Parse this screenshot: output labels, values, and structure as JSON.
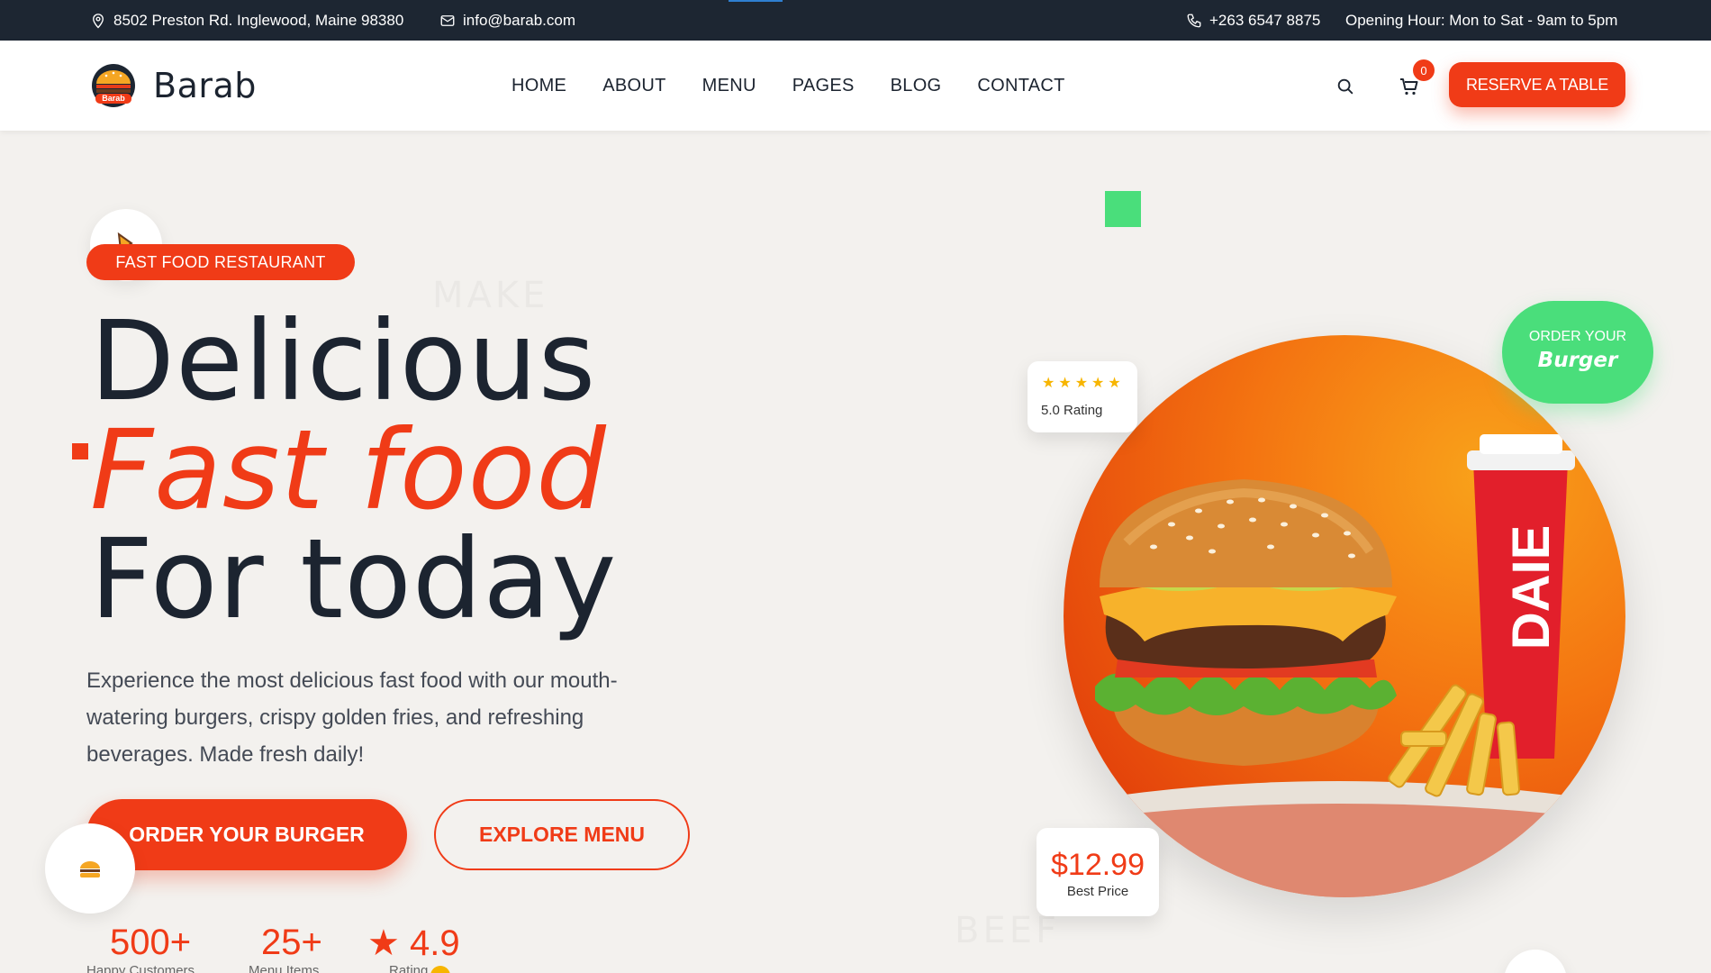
{
  "topbar": {
    "address": "8502 Preston Rd. Inglewood, Maine 98380",
    "email": "info@barab.com",
    "phone": "+263 6547 8875",
    "hours": "Opening Hour: Mon to Sat - 9am to 5pm"
  },
  "header": {
    "logo_text": "Barab",
    "logo_mark_text": "Barab",
    "nav": [
      "HOME",
      "ABOUT",
      "MENU",
      "PAGES",
      "BLOG",
      "CONTACT"
    ],
    "cart_count": "0",
    "reserve_label": "RESERVE A TABLE",
    "icons": [
      "search-icon",
      "cart-icon"
    ]
  },
  "hero": {
    "badge": "FAST FOOD RESTAURANT",
    "title_line1": "Delicious",
    "title_line2": "Fast food",
    "title_line3": "For today",
    "description": "Experience the most delicious fast food with our mouth-watering burgers, crispy golden fries, and refreshing beverages. Made fresh daily!",
    "primary_button": "ORDER YOUR BURGER",
    "secondary_button": "EXPLORE MENU",
    "stats": [
      {
        "value": "500+",
        "label": "Happy Customers"
      },
      {
        "value": "25+",
        "label": "Menu Items"
      },
      {
        "value": "★ 4.9",
        "label": "Rating"
      }
    ]
  },
  "showcase": {
    "stars": "★★★★★",
    "rating_text": "5.0 Rating",
    "order_small": "ORDER YOUR",
    "order_big": "Burger",
    "price": "$12.99",
    "price_label": "Best Price",
    "cup_text": "DAIE"
  },
  "colors": {
    "accent": "#f03b17",
    "green": "#4ade7b",
    "dark": "#1d2632",
    "background": "#f3f1ee"
  }
}
